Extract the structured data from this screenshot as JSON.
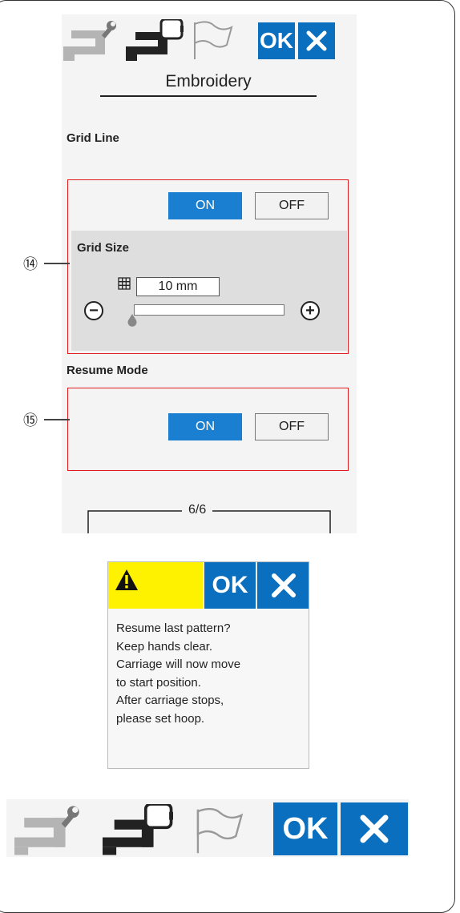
{
  "settings_screen": {
    "toolbar": {
      "icons": [
        "wrench-machine-icon",
        "embroidery-machine-icon",
        "flag-icon"
      ],
      "ok_label": "OK",
      "cancel_icon": "close-icon"
    },
    "title": "Embroidery",
    "grid_line": {
      "label": "Grid Line",
      "on_label": "ON",
      "off_label": "OFF",
      "selected": "ON"
    },
    "grid_size": {
      "label": "Grid Size",
      "value": "10  mm",
      "minus_label": "−",
      "plus_label": "+",
      "icon": "grid-icon"
    },
    "resume_mode": {
      "label": "Resume Mode",
      "on_label": "ON",
      "off_label": "OFF",
      "selected": "ON"
    },
    "page_indicator": "6/6"
  },
  "callouts": {
    "c14": "⑭",
    "c15": "⑮"
  },
  "dialog": {
    "icon": "warning-icon",
    "ok_label": "OK",
    "cancel_icon": "close-icon",
    "lines": [
      "Resume last pattern?",
      "Keep hands clear.",
      "Carriage will now move",
      "to start position.",
      "After carriage stops,",
      "please set hoop."
    ]
  },
  "bottom_toolbar": {
    "icons": [
      "wrench-machine-icon",
      "embroidery-machine-icon",
      "flag-icon"
    ],
    "ok_label": "OK",
    "cancel_icon": "close-icon"
  },
  "colors": {
    "accent": "#0a6fbf",
    "highlight_box": "#e01b1b",
    "warning_yellow": "#fff200"
  }
}
